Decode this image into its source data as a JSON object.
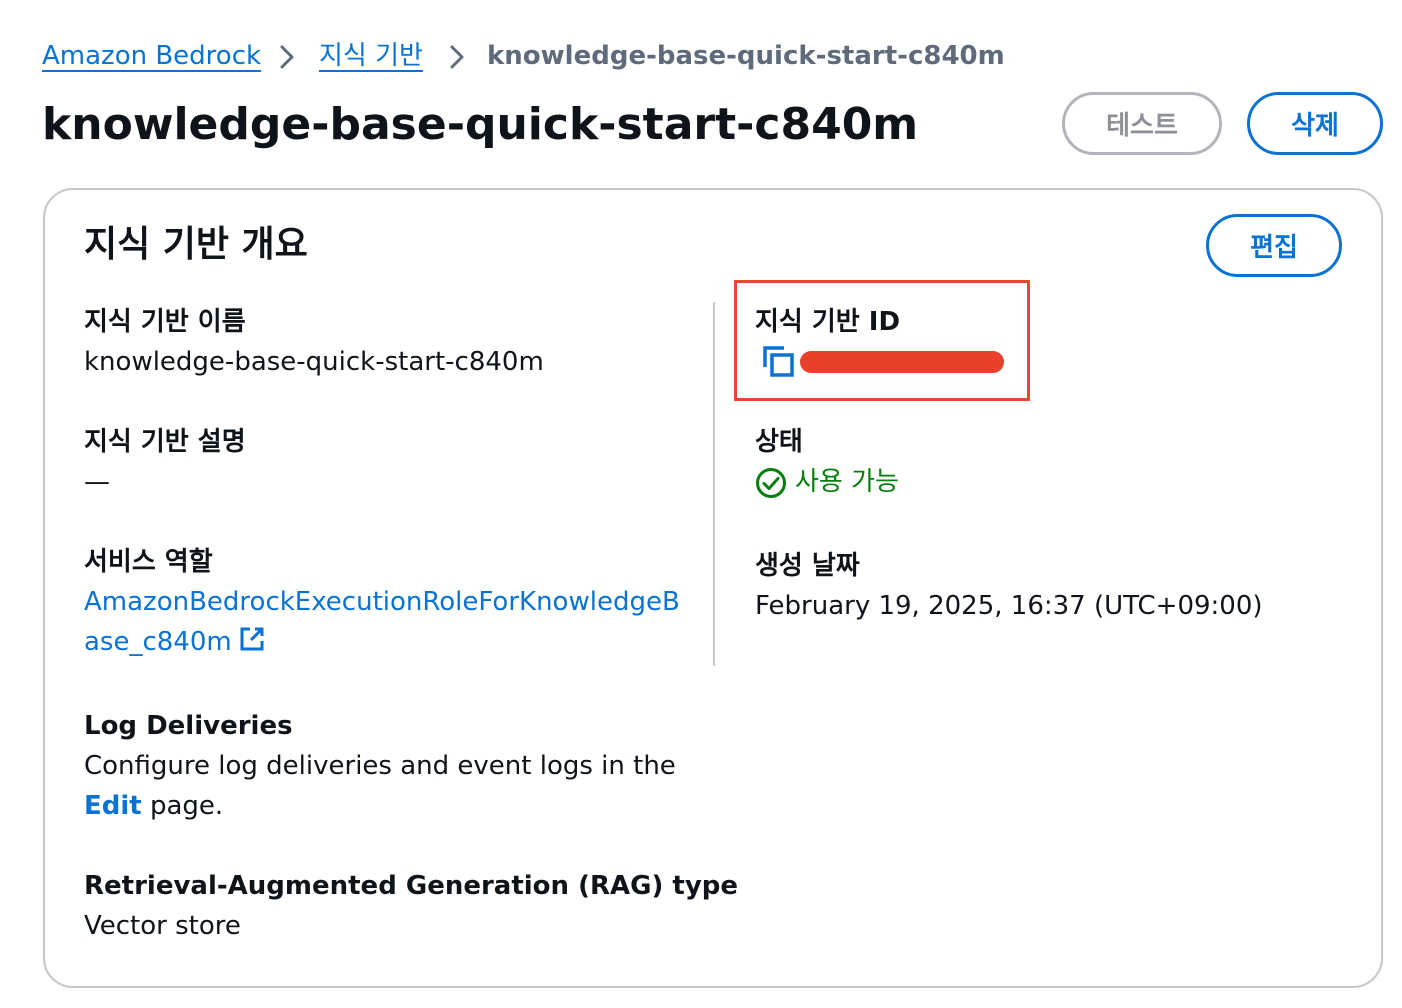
{
  "breadcrumb": {
    "items": [
      "Amazon Bedrock",
      "지식 기반"
    ],
    "current": "knowledge-base-quick-start-c840m"
  },
  "header": {
    "title": "knowledge-base-quick-start-c840m",
    "test_label": "테스트",
    "delete_label": "삭제"
  },
  "overview": {
    "title": "지식 기반 개요",
    "edit_label": "편집",
    "name_label": "지식 기반 이름",
    "name_value": "knowledge-base-quick-start-c840m",
    "description_label": "지식 기반 설명",
    "description_value": "—",
    "service_role_label": "서비스 역할",
    "service_role_line1": "AmazonBedrockExecutionRoleForKnowledgeB",
    "service_role_line2": "ase_c840m",
    "log_label": "Log Deliveries",
    "log_text_line1": "Configure log deliveries and event logs in the",
    "log_link": "Edit",
    "log_text_suffix": " page.",
    "rag_label": "Retrieval-Augmented Generation (RAG) type",
    "rag_value": "Vector store",
    "id_label": "지식 기반 ID",
    "status_label": "상태",
    "status_value": "사용 가능",
    "created_label": "생성 날짜",
    "created_value": "February 19, 2025, 16:37 (UTC+09:00)"
  },
  "colors": {
    "link": "#0972d3",
    "success": "#037f0c",
    "highlight": "#e64a2e",
    "border": "#c6c6cd"
  },
  "icons": [
    "chevron-right-icon",
    "copy-icon",
    "status-available-icon",
    "external-link-icon"
  ]
}
